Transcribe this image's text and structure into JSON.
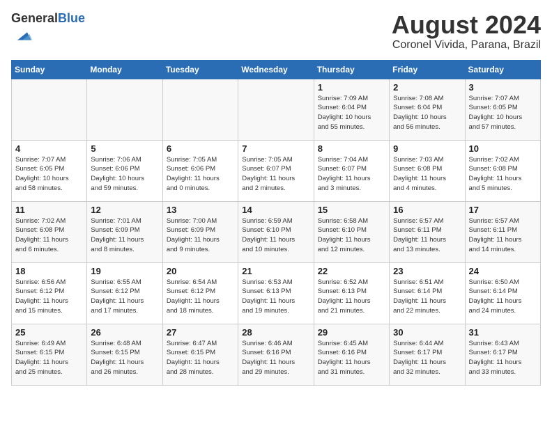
{
  "logo": {
    "general": "General",
    "blue": "Blue"
  },
  "title": "August 2024",
  "location": "Coronel Vivida, Parana, Brazil",
  "days_of_week": [
    "Sunday",
    "Monday",
    "Tuesday",
    "Wednesday",
    "Thursday",
    "Friday",
    "Saturday"
  ],
  "weeks": [
    [
      {
        "day": "",
        "info": ""
      },
      {
        "day": "",
        "info": ""
      },
      {
        "day": "",
        "info": ""
      },
      {
        "day": "",
        "info": ""
      },
      {
        "day": "1",
        "info": "Sunrise: 7:09 AM\nSunset: 6:04 PM\nDaylight: 10 hours\nand 55 minutes."
      },
      {
        "day": "2",
        "info": "Sunrise: 7:08 AM\nSunset: 6:04 PM\nDaylight: 10 hours\nand 56 minutes."
      },
      {
        "day": "3",
        "info": "Sunrise: 7:07 AM\nSunset: 6:05 PM\nDaylight: 10 hours\nand 57 minutes."
      }
    ],
    [
      {
        "day": "4",
        "info": "Sunrise: 7:07 AM\nSunset: 6:05 PM\nDaylight: 10 hours\nand 58 minutes."
      },
      {
        "day": "5",
        "info": "Sunrise: 7:06 AM\nSunset: 6:06 PM\nDaylight: 10 hours\nand 59 minutes."
      },
      {
        "day": "6",
        "info": "Sunrise: 7:05 AM\nSunset: 6:06 PM\nDaylight: 11 hours\nand 0 minutes."
      },
      {
        "day": "7",
        "info": "Sunrise: 7:05 AM\nSunset: 6:07 PM\nDaylight: 11 hours\nand 2 minutes."
      },
      {
        "day": "8",
        "info": "Sunrise: 7:04 AM\nSunset: 6:07 PM\nDaylight: 11 hours\nand 3 minutes."
      },
      {
        "day": "9",
        "info": "Sunrise: 7:03 AM\nSunset: 6:08 PM\nDaylight: 11 hours\nand 4 minutes."
      },
      {
        "day": "10",
        "info": "Sunrise: 7:02 AM\nSunset: 6:08 PM\nDaylight: 11 hours\nand 5 minutes."
      }
    ],
    [
      {
        "day": "11",
        "info": "Sunrise: 7:02 AM\nSunset: 6:08 PM\nDaylight: 11 hours\nand 6 minutes."
      },
      {
        "day": "12",
        "info": "Sunrise: 7:01 AM\nSunset: 6:09 PM\nDaylight: 11 hours\nand 8 minutes."
      },
      {
        "day": "13",
        "info": "Sunrise: 7:00 AM\nSunset: 6:09 PM\nDaylight: 11 hours\nand 9 minutes."
      },
      {
        "day": "14",
        "info": "Sunrise: 6:59 AM\nSunset: 6:10 PM\nDaylight: 11 hours\nand 10 minutes."
      },
      {
        "day": "15",
        "info": "Sunrise: 6:58 AM\nSunset: 6:10 PM\nDaylight: 11 hours\nand 12 minutes."
      },
      {
        "day": "16",
        "info": "Sunrise: 6:57 AM\nSunset: 6:11 PM\nDaylight: 11 hours\nand 13 minutes."
      },
      {
        "day": "17",
        "info": "Sunrise: 6:57 AM\nSunset: 6:11 PM\nDaylight: 11 hours\nand 14 minutes."
      }
    ],
    [
      {
        "day": "18",
        "info": "Sunrise: 6:56 AM\nSunset: 6:12 PM\nDaylight: 11 hours\nand 15 minutes."
      },
      {
        "day": "19",
        "info": "Sunrise: 6:55 AM\nSunset: 6:12 PM\nDaylight: 11 hours\nand 17 minutes."
      },
      {
        "day": "20",
        "info": "Sunrise: 6:54 AM\nSunset: 6:12 PM\nDaylight: 11 hours\nand 18 minutes."
      },
      {
        "day": "21",
        "info": "Sunrise: 6:53 AM\nSunset: 6:13 PM\nDaylight: 11 hours\nand 19 minutes."
      },
      {
        "day": "22",
        "info": "Sunrise: 6:52 AM\nSunset: 6:13 PM\nDaylight: 11 hours\nand 21 minutes."
      },
      {
        "day": "23",
        "info": "Sunrise: 6:51 AM\nSunset: 6:14 PM\nDaylight: 11 hours\nand 22 minutes."
      },
      {
        "day": "24",
        "info": "Sunrise: 6:50 AM\nSunset: 6:14 PM\nDaylight: 11 hours\nand 24 minutes."
      }
    ],
    [
      {
        "day": "25",
        "info": "Sunrise: 6:49 AM\nSunset: 6:15 PM\nDaylight: 11 hours\nand 25 minutes."
      },
      {
        "day": "26",
        "info": "Sunrise: 6:48 AM\nSunset: 6:15 PM\nDaylight: 11 hours\nand 26 minutes."
      },
      {
        "day": "27",
        "info": "Sunrise: 6:47 AM\nSunset: 6:15 PM\nDaylight: 11 hours\nand 28 minutes."
      },
      {
        "day": "28",
        "info": "Sunrise: 6:46 AM\nSunset: 6:16 PM\nDaylight: 11 hours\nand 29 minutes."
      },
      {
        "day": "29",
        "info": "Sunrise: 6:45 AM\nSunset: 6:16 PM\nDaylight: 11 hours\nand 31 minutes."
      },
      {
        "day": "30",
        "info": "Sunrise: 6:44 AM\nSunset: 6:17 PM\nDaylight: 11 hours\nand 32 minutes."
      },
      {
        "day": "31",
        "info": "Sunrise: 6:43 AM\nSunset: 6:17 PM\nDaylight: 11 hours\nand 33 minutes."
      }
    ]
  ]
}
